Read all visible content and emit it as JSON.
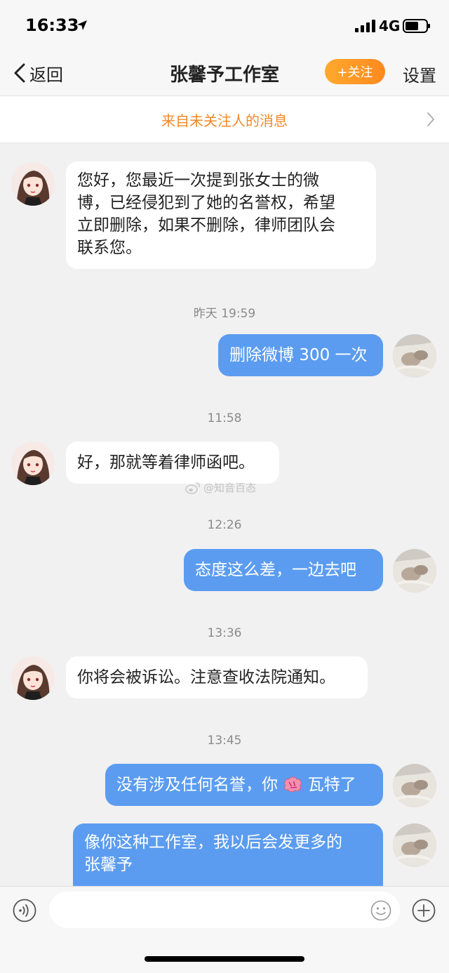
{
  "status_bar": {
    "time": "16:33",
    "network": "4G"
  },
  "nav": {
    "back_label": "返回",
    "title": "张馨予工作室",
    "follow_label": "+关注",
    "settings_label": "设置"
  },
  "notice": {
    "text": "来自未关注人的消息"
  },
  "messages": [
    {
      "side": "in",
      "lines": [
        "您好，您最近一次提到张女士的微",
        "博，已经侵犯到了她的名誉权，希望",
        "立即删除，如果不删除，律师团队会",
        "联系您。"
      ]
    },
    {
      "time": "昨天 19:59"
    },
    {
      "side": "out",
      "lines": [
        "删除微博 300 一次"
      ]
    },
    {
      "time": "11:58"
    },
    {
      "side": "in",
      "lines": [
        "好，那就等着律师函吧。"
      ]
    },
    {
      "time": "12:26"
    },
    {
      "side": "out",
      "lines": [
        "态度这么差，一边去吧"
      ]
    },
    {
      "time": "13:36"
    },
    {
      "side": "in",
      "lines": [
        "你将会被诉讼。注意查收法院通知。"
      ]
    },
    {
      "time": "13:45"
    },
    {
      "side": "out",
      "lines": [
        "没有涉及任何名誉，你",
        "瓦特了"
      ],
      "inline_emoji": "brain-emoji"
    },
    {
      "side": "out",
      "lines": [
        "像你这种工作室，我以后会发更多的",
        "张馨予"
      ]
    }
  ],
  "watermark": {
    "text": "@知音百态"
  },
  "input": {
    "placeholder": ""
  },
  "colors": {
    "accent_orange": "#f0892a",
    "follow_gradient_start": "#ffa82e",
    "outgoing_bubble": "#5b9cf0",
    "incoming_bubble": "#ffffff",
    "background": "#f1f1f1"
  }
}
